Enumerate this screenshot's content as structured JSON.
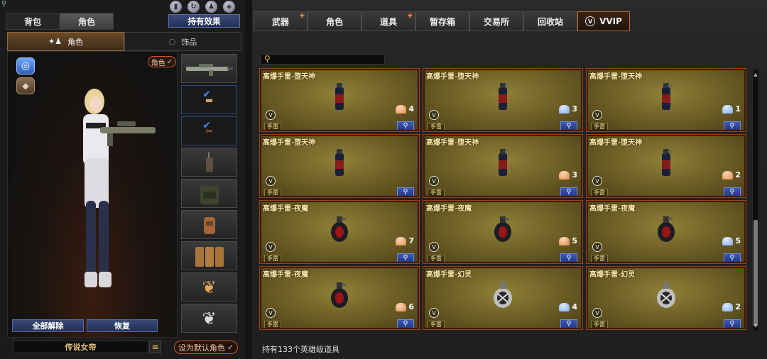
{
  "top_icons": [
    "ranking-icon",
    "refresh-icon",
    "person-icon",
    "bag-icon"
  ],
  "left": {
    "main_tabs": [
      "背包",
      "角色"
    ],
    "effect_button": "持有效果",
    "sub_tabs": [
      "角色",
      "饰品"
    ],
    "role_badge": "角色",
    "buttons": {
      "unequip_all": "全部解除",
      "restore": "恢复"
    },
    "character_name": "传说女帝",
    "default_role_button": "设为默认角色"
  },
  "shop": {
    "tabs": [
      "武器",
      "角色",
      "道具",
      "暂存箱",
      "交易所",
      "回收站",
      "VVIP"
    ],
    "search": {
      "placeholder": ""
    },
    "items": [
      {
        "name": "高爆手雷-堕天神",
        "type": "手雷",
        "count": "4",
        "cap": "orange",
        "model": "can"
      },
      {
        "name": "高爆手雷-堕天神",
        "type": "手雷",
        "count": "3",
        "cap": "blue",
        "model": "can"
      },
      {
        "name": "高爆手雷-堕天神",
        "type": "手雷",
        "count": "1",
        "cap": "blue",
        "model": "can"
      },
      {
        "name": "高爆手雷-堕天神",
        "type": "手雷",
        "count": "",
        "cap": "",
        "model": "can"
      },
      {
        "name": "高爆手雷-堕天神",
        "type": "手雷",
        "count": "3",
        "cap": "orange",
        "model": "can"
      },
      {
        "name": "高爆手雷-堕天神",
        "type": "手雷",
        "count": "2",
        "cap": "orange",
        "model": "can"
      },
      {
        "name": "高爆手雷-夜魔",
        "type": "手雷",
        "count": "7",
        "cap": "orange",
        "model": "round"
      },
      {
        "name": "高爆手雷-夜魔",
        "type": "手雷",
        "count": "5",
        "cap": "orange",
        "model": "round"
      },
      {
        "name": "高爆手雷-夜魔",
        "type": "手雷",
        "count": "5",
        "cap": "blue",
        "model": "round"
      },
      {
        "name": "高爆手雷-夜魔",
        "type": "手雷",
        "count": "6",
        "cap": "orange",
        "model": "round"
      },
      {
        "name": "高爆手雷-幻灵",
        "type": "手雷",
        "count": "4",
        "cap": "blue",
        "model": "silver"
      },
      {
        "name": "高爆手雷-幻灵",
        "type": "手雷",
        "count": "2",
        "cap": "blue",
        "model": "silver"
      }
    ],
    "owned_text": "持有133个英雄级道具"
  }
}
